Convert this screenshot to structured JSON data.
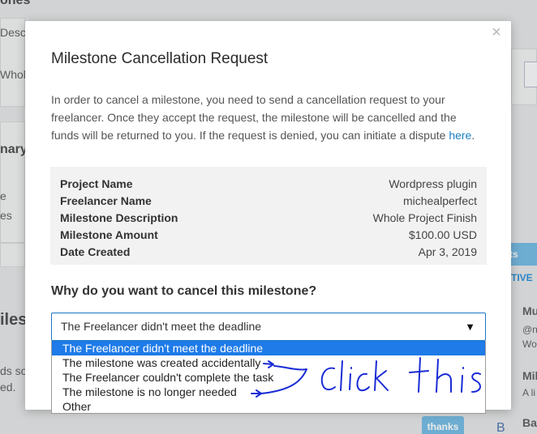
{
  "background": {
    "heading_1": "ones",
    "desc_fragment": "Desc",
    "whole_fragment": "Whole",
    "summary_fragment": "nary",
    "e_fragment": "e",
    "es_fragment": "es",
    "miles_fragment": "iles",
    "ds_fragment": "ds so",
    "ed_fragment": "ed.",
    "tab_ts": "ts",
    "tab_tive": "TIVE",
    "mu_fragment": "Mu",
    "at_fragment": "@n",
    "wo_fragment": "Wo",
    "mi_fragment": "Mil",
    "al_fragment": "A li",
    "ba_fragment": "Bai",
    "b_avatar": "B",
    "thanks_button": "thanks"
  },
  "modal": {
    "title": "Milestone Cancellation Request",
    "intro_text": "In order to cancel a milestone, you need to send a cancellation request to your freelancer. Once they accept the request, the milestone will be cancelled and the funds will be returned to you. If the request is denied, you can initiate a dispute ",
    "intro_link": "here",
    "intro_end": ".",
    "close_symbol": "×",
    "details": [
      {
        "label": "Project Name",
        "value": "Wordpress plugin"
      },
      {
        "label": "Freelancer Name",
        "value": "michealperfect"
      },
      {
        "label": "Milestone Description",
        "value": "Whole Project Finish"
      },
      {
        "label": "Milestone Amount",
        "value": "$100.00 USD"
      },
      {
        "label": "Date Created",
        "value": "Apr 3, 2019"
      }
    ],
    "question": "Why do you want to cancel this milestone?",
    "select_value": "The Freelancer didn't meet the deadline",
    "options": [
      "The Freelancer didn't meet the deadline",
      "The milestone was created accidentally",
      "The Freelancer couldn't complete the task",
      "The milestone is no longer needed",
      "Other"
    ],
    "selected_option_index": 0
  },
  "annotation": {
    "handwritten_text": "click this",
    "ink_color": "#1a2bd6"
  }
}
